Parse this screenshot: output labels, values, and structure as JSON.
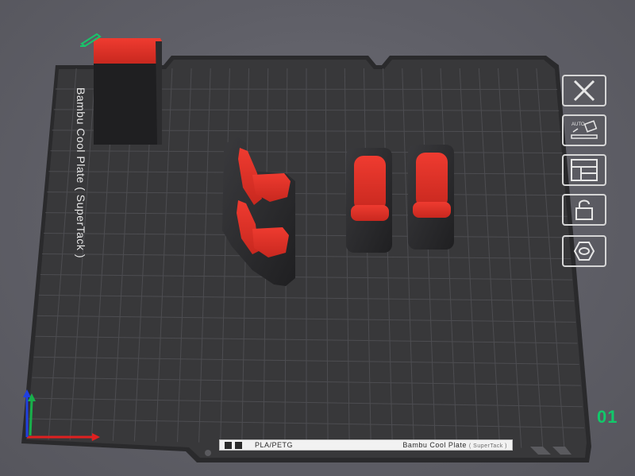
{
  "plate": {
    "side_text": "Bambu Cool Plate ( SuperTack )",
    "filament_label": "PLA/PETG",
    "type_label": "Bambu Cool Plate",
    "type_sub": "( SuperTack )",
    "number": "01"
  },
  "toolbar": {
    "items": [
      {
        "name": "close-plate-button",
        "icon": "close-icon"
      },
      {
        "name": "auto-orient-button",
        "icon": "auto-orient-icon",
        "text": "AUTO"
      },
      {
        "name": "arrange-button",
        "icon": "arrange-icon"
      },
      {
        "name": "lock-button",
        "icon": "lock-icon"
      },
      {
        "name": "plate-settings-button",
        "icon": "hex-nut-icon"
      }
    ]
  },
  "colors": {
    "plate": "#3a3a3c",
    "grid": "#5b5b5e",
    "model_red": "#e0322a",
    "model_dark": "#2a2a2c",
    "axis_x": "#e02020",
    "axis_y": "#19b04a",
    "axis_z": "#2040e0",
    "plate_number": "#11c96a"
  }
}
